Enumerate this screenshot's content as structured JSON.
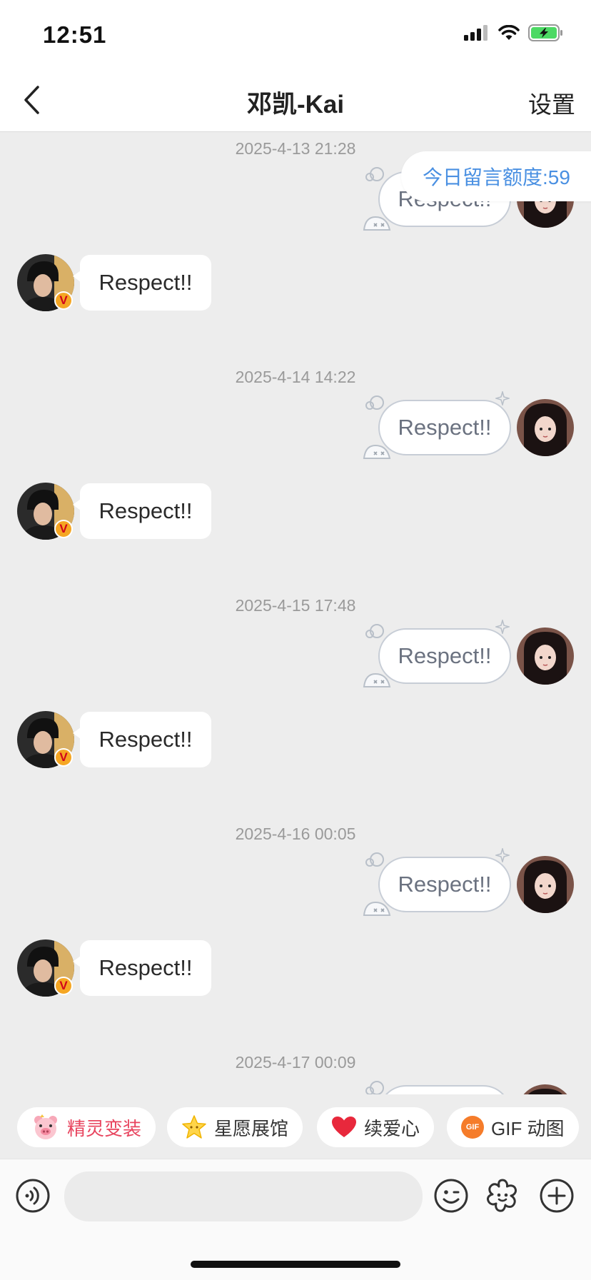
{
  "status_bar": {
    "time": "12:51",
    "battery_color": "#4cd964"
  },
  "nav": {
    "title": "邓凯-Kai",
    "settings_label": "设置",
    "back_icon": "chevron-left-icon"
  },
  "quota": {
    "text": "今日留言额度:59",
    "color": "#4a90e2"
  },
  "messages": [
    {
      "timestamp": "2025-4-13 21:28",
      "sent": "Respect!!",
      "received": "Respect!!"
    },
    {
      "timestamp": "2025-4-14 14:22",
      "sent": "Respect!!",
      "received": "Respect!!"
    },
    {
      "timestamp": "2025-4-15 17:48",
      "sent": "Respect!!",
      "received": "Respect!!"
    },
    {
      "timestamp": "2025-4-16 00:05",
      "sent": "Respect!!",
      "received": "Respect!!"
    },
    {
      "timestamp": "2025-4-17 00:09"
    }
  ],
  "contact": {
    "verified_badge": "V",
    "badge_color": "#f5a623"
  },
  "quick_actions": [
    {
      "label": "精灵变装",
      "icon": "pig-face-icon",
      "color": "#e8455f"
    },
    {
      "label": "星愿展馆",
      "icon": "star-icon",
      "color": "#333333"
    },
    {
      "label": "续爱心",
      "icon": "heart-icon",
      "color": "#333333"
    },
    {
      "label": "GIF 动图",
      "icon": "gif-icon",
      "color": "#333333"
    }
  ],
  "gif_icon_text": "GIF",
  "input_bar": {
    "voice_icon": "voice-icon",
    "emoji_icon": "emoji-icon",
    "flower_icon": "flower-icon",
    "plus_icon": "plus-icon"
  }
}
